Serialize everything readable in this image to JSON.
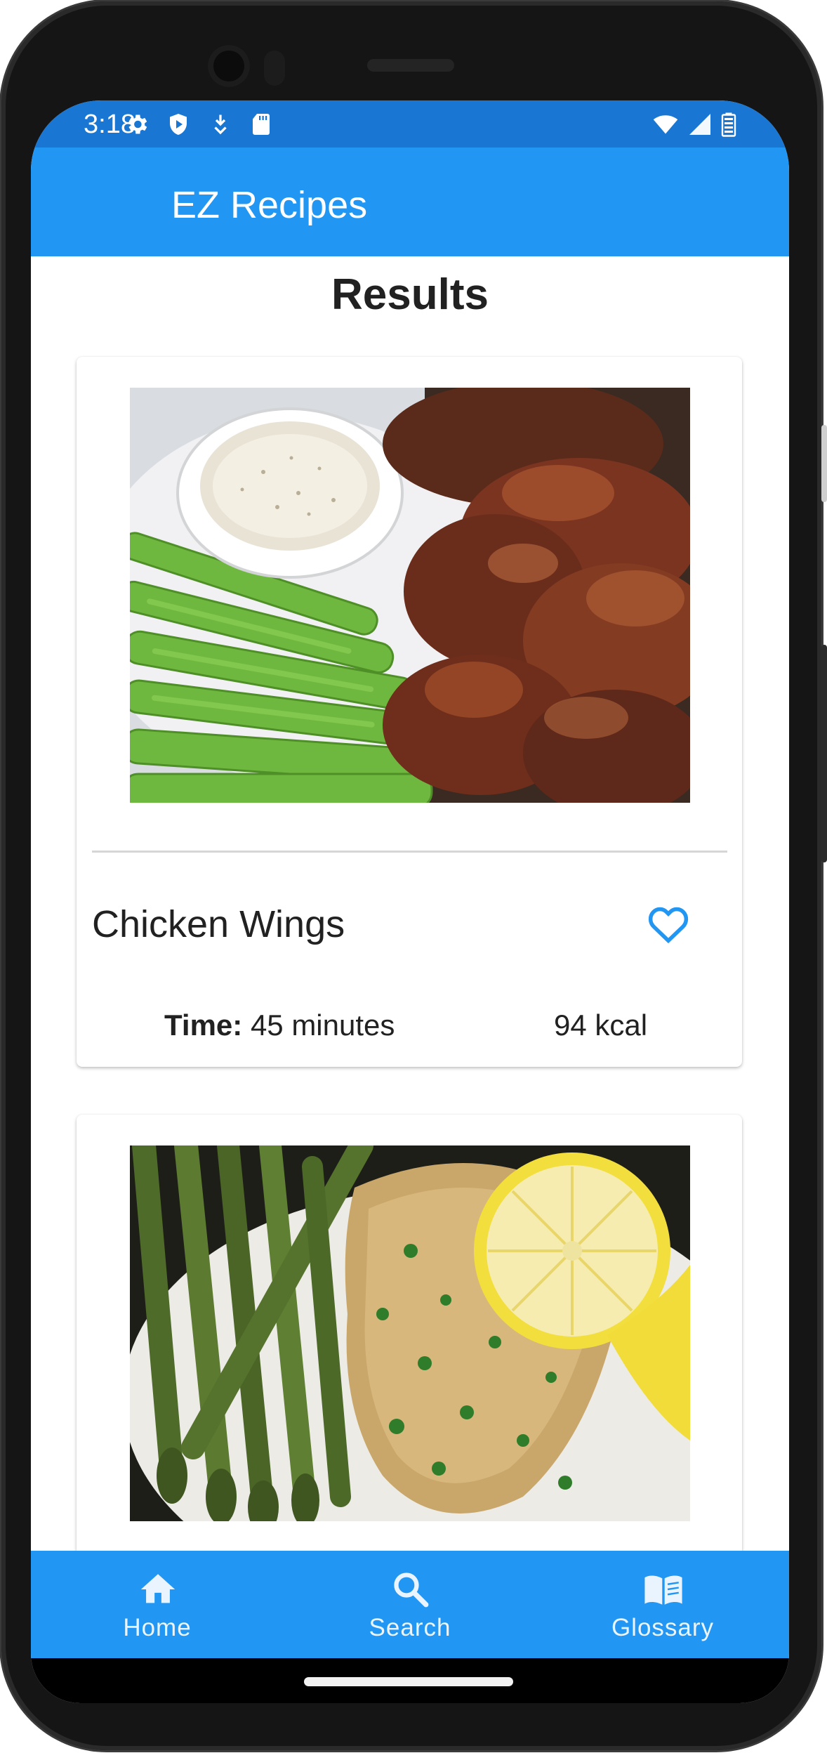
{
  "status_bar": {
    "time": "3:18",
    "left_icons": [
      "gear-icon",
      "shield-icon",
      "download-icon",
      "sd-card-icon"
    ],
    "right_icons": [
      "wifi-icon",
      "cell-signal-icon",
      "battery-icon"
    ],
    "color": "#1976d2"
  },
  "app_bar": {
    "title": "EZ Recipes",
    "color": "#2196f3"
  },
  "page": {
    "heading": "Results"
  },
  "results": [
    {
      "name": "Chicken Wings",
      "time_label": "Time:",
      "time_value": "45 minutes",
      "calories": "94 kcal",
      "favorite_icon": "heart-outline-icon",
      "image": "chicken-wings-photo"
    },
    {
      "image": "chicken-asparagus-lemon-photo"
    }
  ],
  "bottom_nav": {
    "items": [
      {
        "label": "Home",
        "icon": "home-icon"
      },
      {
        "label": "Search",
        "icon": "search-icon"
      },
      {
        "label": "Glossary",
        "icon": "book-icon"
      }
    ],
    "color": "#2196f3"
  }
}
